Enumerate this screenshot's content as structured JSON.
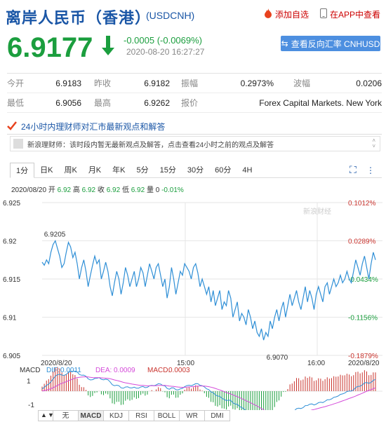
{
  "header": {
    "title": "离岸人民币（香港）",
    "code": "(USDCNH)",
    "add_favorite": "添加自选",
    "app_view": "在APP中查看"
  },
  "quote": {
    "price": "6.9177",
    "change": "-0.0005 (-0.0069%)",
    "time": "2020-08-20 16:27:27",
    "reverse_button": "查看反向汇率 CNHUSD"
  },
  "stats": {
    "row1": [
      {
        "k": "今开",
        "v": "6.9183"
      },
      {
        "k": "昨收",
        "v": "6.9182"
      },
      {
        "k": "振幅",
        "v": "0.2973%"
      },
      {
        "k": "波幅",
        "v": "0.0206"
      }
    ],
    "row2": [
      {
        "k": "最低",
        "v": "6.9056"
      },
      {
        "k": "最高",
        "v": "6.9262"
      },
      {
        "k": "报价",
        "v": "Forex Capital Markets. New York"
      }
    ]
  },
  "banner": {
    "text": "24小时内理财师对汇市最新观点和解答",
    "message": "新浪理财师：该时段内暂无最新观点及解答，点击查看24小时之前的观点及解答"
  },
  "tabs": [
    "1分",
    "日K",
    "周K",
    "月K",
    "年K",
    "5分",
    "15分",
    "30分",
    "60分",
    "4H"
  ],
  "active_tab": "1分",
  "ohlc": {
    "date": "2020/08/20",
    "open_label": "开",
    "open": "6.92",
    "high_label": "高",
    "high": "6.92",
    "close_label": "收",
    "close": "6.92",
    "low_label": "低",
    "low": "6.92",
    "vol_label": "量",
    "vol": "0",
    "change": "-0.01%"
  },
  "chart_data": {
    "type": "line",
    "y_ticks": [
      "6.925",
      "6.92",
      "6.915",
      "6.91",
      "6.905"
    ],
    "right_ticks": [
      "0.1012%",
      "0.0289%",
      "-0.0434%",
      "-0.1156%",
      "-0.1879%"
    ],
    "ylim": [
      6.905,
      6.925
    ],
    "x_ticks": [
      "2020/8/20",
      "15:00",
      "16:00",
      "2020/8/20"
    ],
    "annotations": {
      "high": "6.9205",
      "low": "6.9070"
    },
    "watermark": "新浪财经",
    "series": [
      {
        "values": [
          6.9172,
          6.9168,
          6.9175,
          6.917,
          6.9185,
          6.9195,
          6.92,
          6.919,
          6.918,
          6.9165,
          6.917,
          6.9185,
          6.9198,
          6.9192,
          6.9178,
          6.9185,
          6.917,
          6.915,
          6.9165,
          6.9175,
          6.916,
          6.914,
          6.9155,
          6.9168,
          6.918,
          6.917,
          6.9175,
          6.915,
          6.916,
          6.9172,
          6.916,
          6.914,
          6.9128,
          6.9145,
          6.916,
          6.915,
          6.913,
          6.9145,
          6.9165,
          6.9155,
          6.914,
          6.915,
          6.916,
          6.914,
          6.915,
          6.9165,
          6.9158,
          6.914,
          6.9155,
          6.917,
          6.916,
          6.915,
          6.9165,
          6.917,
          6.9155,
          6.914,
          6.915,
          6.9125,
          6.914,
          6.9165,
          6.915,
          6.913,
          6.9145,
          6.916,
          6.9155,
          6.917,
          6.9165,
          6.916,
          6.915,
          6.9165,
          6.917,
          6.9158,
          6.914,
          6.915,
          6.914,
          6.913,
          6.914,
          6.912,
          6.9135,
          6.9115,
          6.9125,
          6.9135,
          6.911,
          6.912,
          6.9115,
          6.9135,
          6.9125,
          6.91,
          6.911,
          6.912,
          6.9095,
          6.9105,
          6.91,
          6.909,
          6.911,
          6.91,
          6.9085,
          6.9095,
          6.908,
          6.9075,
          6.9085,
          6.907,
          6.908,
          6.9075,
          6.9095,
          6.9085,
          6.91,
          6.911,
          6.9095,
          6.911,
          6.912,
          6.91,
          6.9115,
          6.913,
          6.9115,
          6.9125,
          6.9135,
          6.912,
          6.911,
          6.9125,
          6.914,
          6.912,
          6.9135,
          6.9125,
          6.911,
          6.913,
          6.914,
          6.913,
          6.912,
          6.914,
          6.9145,
          6.913,
          6.914,
          6.915,
          6.914,
          6.9145,
          6.9155,
          6.9145,
          6.915,
          6.916,
          6.915,
          6.9145,
          6.916,
          6.9175,
          6.9165,
          6.9155,
          6.917,
          6.918,
          6.9165,
          6.915,
          6.917,
          6.9185,
          6.9175
        ]
      }
    ],
    "macd": {
      "label": "MACD",
      "dif_label": "DIF:",
      "dif": "0.0011",
      "dea_label": "DEA:",
      "dea": "0.0009",
      "macd_label": "MACD:",
      "macd": "0.0003",
      "y_ticks": [
        "1",
        "-1"
      ]
    }
  },
  "indicator_tabs": [
    "无",
    "MACD",
    "KDJ",
    "RSI",
    "BOLL",
    "WR",
    "DMI"
  ],
  "active_indicator": "MACD"
}
